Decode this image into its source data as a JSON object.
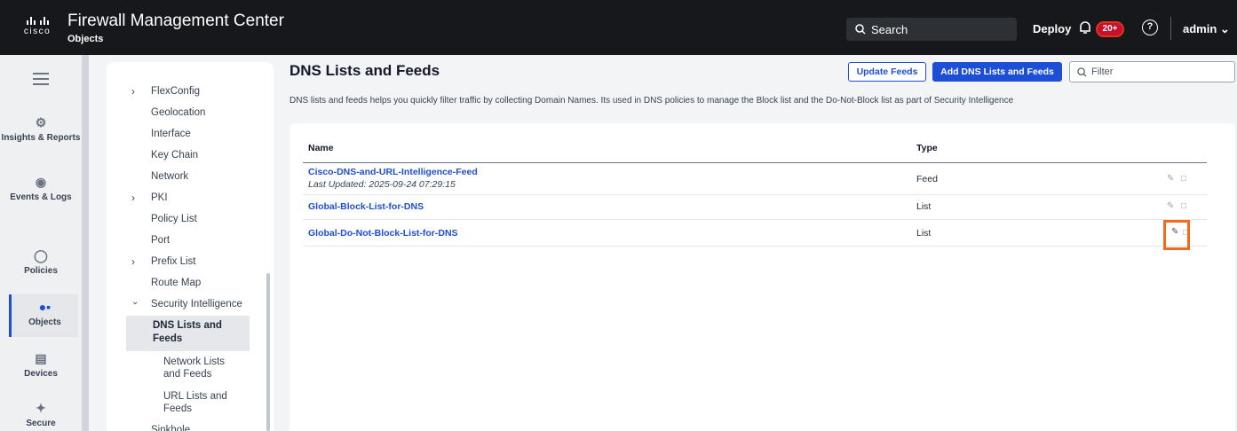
{
  "header": {
    "logo_text": "cisco",
    "app_title": "Firewall Management Center",
    "breadcrumb": "Objects",
    "search_label": "Search",
    "deploy_label": "Deploy",
    "notifications": "20+",
    "user": "admin",
    "colors": {
      "bar": "#16181b",
      "badge": "#c8102e"
    }
  },
  "leftnav": {
    "items": [
      {
        "label": "Insights & Reports",
        "icon": "insights-icon"
      },
      {
        "label": "Events & Logs",
        "icon": "events-icon"
      },
      {
        "label": "Policies",
        "icon": "shield-icon"
      },
      {
        "label": "Objects",
        "icon": "objects-icon"
      },
      {
        "label": "Devices",
        "icon": "devices-icon"
      },
      {
        "label": "Secure",
        "icon": "secure-icon"
      }
    ],
    "active": "Objects"
  },
  "tree": {
    "items": [
      {
        "label": "FlexConfig",
        "expandable": true
      },
      {
        "label": "Geolocation"
      },
      {
        "label": "Interface"
      },
      {
        "label": "Key Chain"
      },
      {
        "label": "Network"
      },
      {
        "label": "PKI",
        "expandable": true
      },
      {
        "label": "Policy List"
      },
      {
        "label": "Port"
      },
      {
        "label": "Prefix List",
        "expandable": true
      },
      {
        "label": "Route Map"
      },
      {
        "label": "Security Intelligence",
        "expanded": true
      }
    ],
    "sub_items": [
      {
        "line1": "DNS Lists and",
        "line2": "Feeds",
        "selected": true
      },
      {
        "line1": "Network Lists",
        "line2": "and Feeds"
      },
      {
        "line1": "URL Lists and",
        "line2": "Feeds"
      }
    ],
    "last": "Sinkhole"
  },
  "main": {
    "title": "DNS Lists and Feeds",
    "update_feeds": "Update Feeds",
    "add_button": "Add DNS Lists and Feeds",
    "filter_placeholder": "Filter",
    "description": "DNS lists and feeds helps you quickly filter traffic by collecting Domain Names. Its used in DNS policies to manage the Block list and the Do-Not-Block list as part of Security Intelligence",
    "columns": {
      "name": "Name",
      "type": "Type"
    },
    "rows": [
      {
        "name": "Cisco-DNS-and-URL-Intelligence-Feed",
        "sub": "Last Updated: 2025-09-24 07:29:15",
        "type": "Feed"
      },
      {
        "name": "Global-Block-List-for-DNS",
        "type": "List"
      },
      {
        "name": "Global-Do-Not-Block-List-for-DNS",
        "type": "List"
      }
    ],
    "accent": "#1d4ed8",
    "highlight_color": "#f26a1b"
  }
}
